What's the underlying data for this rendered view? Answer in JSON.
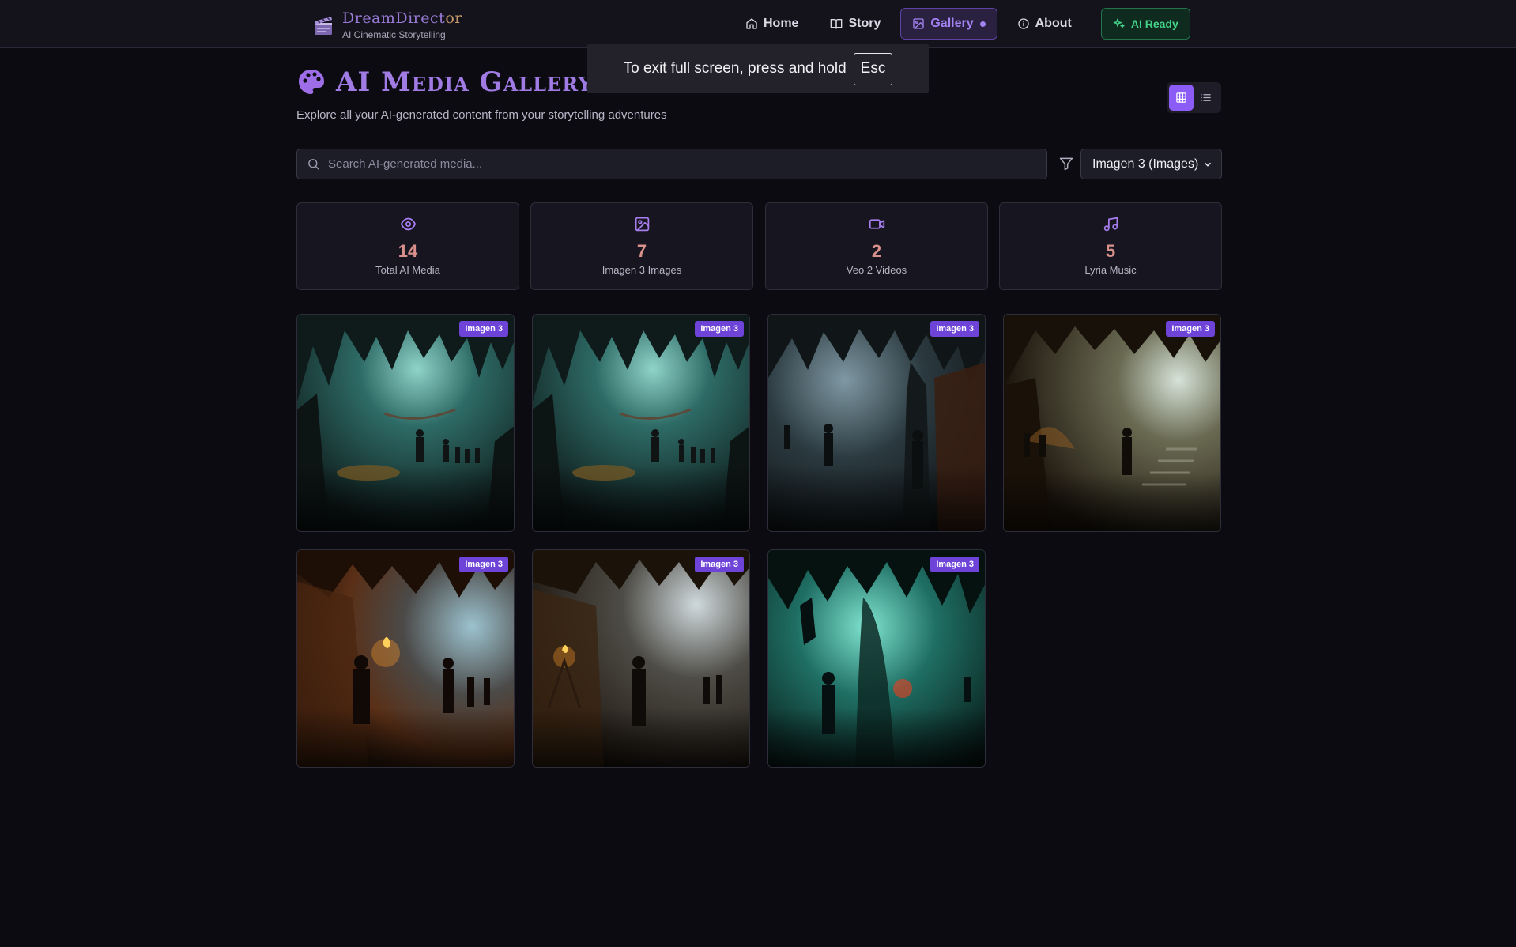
{
  "brand": {
    "name_main": "DreamDirect",
    "name_tail": "or",
    "tagline": "AI Cinematic Storytelling",
    "accent_color": "#9a7bd6"
  },
  "nav": {
    "items": [
      {
        "label": "Home",
        "icon": "home-icon"
      },
      {
        "label": "Story",
        "icon": "book-icon"
      },
      {
        "label": "Gallery",
        "icon": "image-icon",
        "active": true
      },
      {
        "label": "About",
        "icon": "info-icon"
      }
    ],
    "status_label": "AI Ready",
    "status_color": "#42d48a"
  },
  "toast": {
    "message": "To exit full screen, press and hold",
    "key": "Esc"
  },
  "page": {
    "title": "AI Media Gallery",
    "subtitle": "Explore all your AI-generated content from your storytelling adventures"
  },
  "search": {
    "placeholder": "Search AI-generated media..."
  },
  "filter": {
    "selected": "Imagen 3 (Images)"
  },
  "stats": [
    {
      "value": "14",
      "label": "Total AI Media",
      "icon": "eye-icon"
    },
    {
      "value": "7",
      "label": "Imagen 3 Images",
      "icon": "image-icon"
    },
    {
      "value": "2",
      "label": "Veo 2 Videos",
      "icon": "video-icon"
    },
    {
      "value": "5",
      "label": "Lyria Music",
      "icon": "music-icon"
    }
  ],
  "gallery": {
    "items": [
      {
        "badge": "Imagen 3"
      },
      {
        "badge": "Imagen 3"
      },
      {
        "badge": "Imagen 3"
      },
      {
        "badge": "Imagen 3"
      },
      {
        "badge": "Imagen 3"
      },
      {
        "badge": "Imagen 3"
      },
      {
        "badge": "Imagen 3"
      }
    ],
    "badge_color": "#6d43d8"
  }
}
